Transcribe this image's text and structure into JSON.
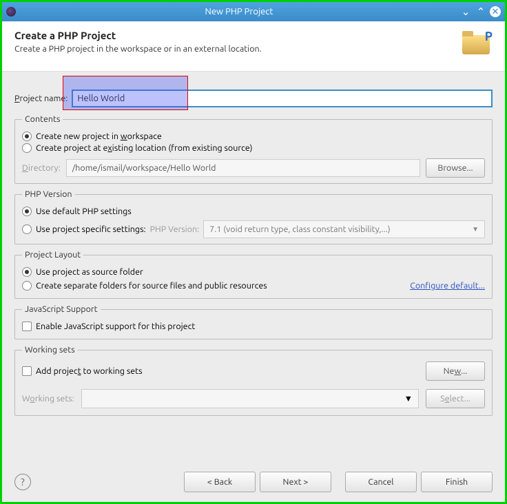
{
  "window": {
    "title": "New PHP Project"
  },
  "header": {
    "title": "Create a PHP Project",
    "subtitle": "Create a PHP project in the workspace or in an external location."
  },
  "projectName": {
    "label": "Project name:",
    "value": "Hello World"
  },
  "contents": {
    "legend": "Contents",
    "opt1": "Create new project in workspace",
    "opt2": "Create project at existing location (from existing source)",
    "dirLabel": "Directory:",
    "dirValue": "/home/ismail/workspace/Hello World",
    "browse": "Browse..."
  },
  "phpVersion": {
    "legend": "PHP Version",
    "opt1": "Use default PHP settings",
    "opt2": "Use project specific settings:",
    "verLabel": "PHP Version:",
    "verValue": "7.1 (void return type, class constant visibility,...)"
  },
  "layout": {
    "legend": "Project Layout",
    "opt1": "Use project as source folder",
    "opt2": "Create separate folders for source files and public resources",
    "configLink": "Configure default..."
  },
  "js": {
    "legend": "JavaScript Support",
    "check": "Enable JavaScript support for this project"
  },
  "ws": {
    "legend": "Working sets",
    "check": "Add project to working sets",
    "newBtn": "New...",
    "label": "Working sets:",
    "selectBtn": "Select..."
  },
  "footer": {
    "back": "< Back",
    "next": "Next >",
    "cancel": "Cancel",
    "finish": "Finish"
  }
}
